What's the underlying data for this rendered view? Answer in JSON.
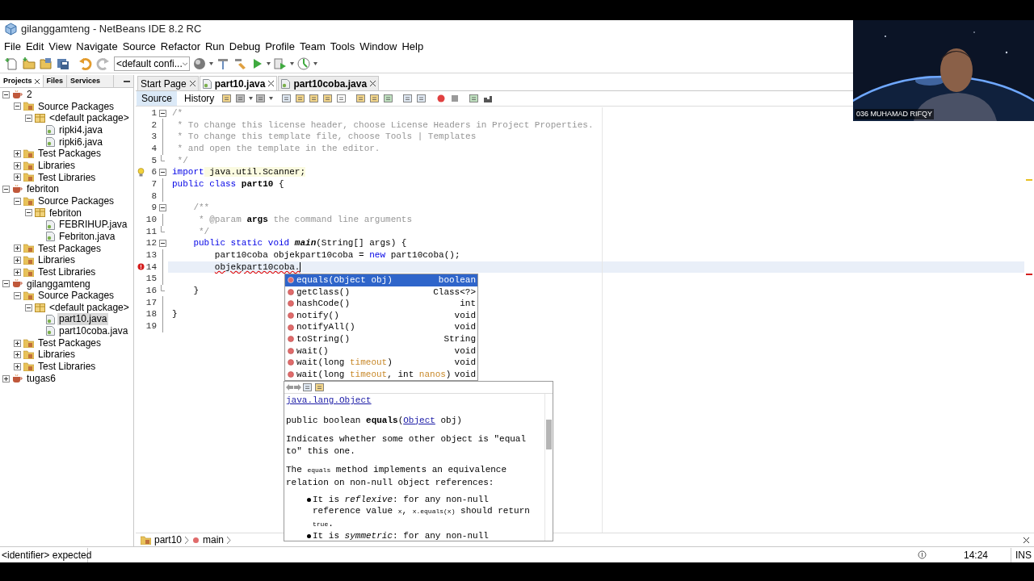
{
  "window": {
    "title": "gilanggamteng - NetBeans IDE 8.2 RC"
  },
  "menu": [
    "File",
    "Edit",
    "View",
    "Navigate",
    "Source",
    "Refactor",
    "Run",
    "Debug",
    "Profile",
    "Team",
    "Tools",
    "Window",
    "Help"
  ],
  "toolbar": {
    "config": "<default confi..."
  },
  "panel_tabs": [
    {
      "label": "Projects",
      "selected": true,
      "closable": true
    },
    {
      "label": "Files",
      "selected": false,
      "closable": false
    },
    {
      "label": "Services",
      "selected": false,
      "closable": false
    }
  ],
  "tree": [
    {
      "label": "2",
      "kind": "project",
      "expanded": true,
      "selected": false,
      "children": [
        {
          "label": "Source Packages",
          "kind": "folder",
          "expanded": true,
          "selected": false,
          "children": [
            {
              "label": "<default package>",
              "kind": "package",
              "expanded": true,
              "selected": false,
              "children": [
                {
                  "label": "ripki4.java",
                  "kind": "file",
                  "selected": false
                },
                {
                  "label": "ripki6.java",
                  "kind": "file",
                  "selected": false
                }
              ]
            }
          ]
        },
        {
          "label": "Test Packages",
          "kind": "folder",
          "expanded": false,
          "selected": false
        },
        {
          "label": "Libraries",
          "kind": "folder",
          "expanded": false,
          "selected": false
        },
        {
          "label": "Test Libraries",
          "kind": "folder",
          "expanded": false,
          "selected": false
        }
      ]
    },
    {
      "label": "febriton",
      "kind": "project",
      "expanded": true,
      "selected": false,
      "children": [
        {
          "label": "Source Packages",
          "kind": "folder",
          "expanded": true,
          "selected": false,
          "children": [
            {
              "label": "febriton",
              "kind": "package",
              "expanded": true,
              "selected": false,
              "children": [
                {
                  "label": "FEBRIHUP.java",
                  "kind": "file",
                  "selected": false
                },
                {
                  "label": "Febriton.java",
                  "kind": "file",
                  "selected": false
                }
              ]
            }
          ]
        },
        {
          "label": "Test Packages",
          "kind": "folder",
          "expanded": false,
          "selected": false
        },
        {
          "label": "Libraries",
          "kind": "folder",
          "expanded": false,
          "selected": false
        },
        {
          "label": "Test Libraries",
          "kind": "folder",
          "expanded": false,
          "selected": false
        }
      ]
    },
    {
      "label": "gilanggamteng",
      "kind": "project",
      "expanded": true,
      "selected": false,
      "children": [
        {
          "label": "Source Packages",
          "kind": "folder",
          "expanded": true,
          "selected": false,
          "children": [
            {
              "label": "<default package>",
              "kind": "package",
              "expanded": true,
              "selected": false,
              "children": [
                {
                  "label": "part10.java",
                  "kind": "file",
                  "selected": true
                },
                {
                  "label": "part10coba.java",
                  "kind": "file",
                  "selected": false
                }
              ]
            }
          ]
        },
        {
          "label": "Test Packages",
          "kind": "folder",
          "expanded": false,
          "selected": false
        },
        {
          "label": "Libraries",
          "kind": "folder",
          "expanded": false,
          "selected": false
        },
        {
          "label": "Test Libraries",
          "kind": "folder",
          "expanded": false,
          "selected": false
        }
      ]
    },
    {
      "label": "tugas6",
      "kind": "project",
      "expanded": false,
      "selected": false
    }
  ],
  "editor_tabs": [
    {
      "label": "Start Page",
      "selected": false,
      "modified": false
    },
    {
      "label": "part10.java",
      "selected": true,
      "modified": true
    },
    {
      "label": "part10coba.java",
      "selected": false,
      "modified": true
    }
  ],
  "view_toggle": [
    {
      "label": "Source",
      "selected": true
    },
    {
      "label": "History",
      "selected": false
    }
  ],
  "code_lines": [
    {
      "number": "1",
      "current": false,
      "expanded": true,
      "segments": [
        {
          "text": "/*",
          "kind": "comment"
        }
      ]
    },
    {
      "number": "2",
      "current": false,
      "segments": [
        {
          "text": " * To change this license header, choose License Headers in Project Properties.",
          "kind": "comment"
        }
      ]
    },
    {
      "number": "3",
      "current": false,
      "segments": [
        {
          "text": " * To change this template file, choose Tools | Templates",
          "kind": "comment"
        }
      ]
    },
    {
      "number": "4",
      "current": false,
      "segments": [
        {
          "text": " * and open the template in the editor.",
          "kind": "comment"
        }
      ]
    },
    {
      "number": "5",
      "current": false,
      "fold_end": true,
      "segments": [
        {
          "text": " */",
          "kind": "comment"
        }
      ]
    },
    {
      "number": "6",
      "current": false,
      "expanded": true,
      "hint": true,
      "segments": [
        {
          "text": "import",
          "kind": "keyword"
        },
        {
          "text": " java.util.Scanner;",
          "kind": "warning"
        }
      ]
    },
    {
      "number": "7",
      "current": false,
      "segments": [
        {
          "text": "public class ",
          "kind": "keyword"
        },
        {
          "text": "part10",
          "kind": "bold"
        },
        {
          "text": " {",
          "kind": "plain"
        }
      ]
    },
    {
      "number": "8",
      "current": false
    },
    {
      "number": "9",
      "current": false,
      "expanded": true,
      "segments": [
        {
          "text": "    /**",
          "kind": "comment"
        }
      ]
    },
    {
      "number": "10",
      "current": false,
      "segments": [
        {
          "text": "     * @param ",
          "kind": "comment"
        },
        {
          "text": "args",
          "kind": "bold"
        },
        {
          "text": " the command line arguments",
          "kind": "comment"
        }
      ]
    },
    {
      "number": "11",
      "current": false,
      "fold_end": true,
      "segments": [
        {
          "text": "     */",
          "kind": "comment"
        }
      ]
    },
    {
      "number": "12",
      "current": false,
      "expanded": true,
      "segments": [
        {
          "text": "    public static void ",
          "kind": "keyword"
        },
        {
          "text": "main",
          "kind": "method"
        },
        {
          "text": "(String[] args) {",
          "kind": "plain"
        }
      ]
    },
    {
      "number": "13",
      "current": false,
      "segments": [
        {
          "text": "        part10coba objekpart10coba = ",
          "kind": "plain"
        },
        {
          "text": "new",
          "kind": "keyword"
        },
        {
          "text": " part10coba();",
          "kind": "plain"
        }
      ]
    },
    {
      "number": "14",
      "current": true,
      "error": true,
      "segments": [
        {
          "text": "        objekpart10coba.",
          "kind": "error"
        }
      ]
    },
    {
      "number": "15",
      "current": false
    },
    {
      "number": "16",
      "current": false,
      "fold_end": true,
      "segments": [
        {
          "text": "    }",
          "kind": "plain"
        }
      ]
    },
    {
      "number": "17",
      "current": false
    },
    {
      "number": "18",
      "current": false,
      "segments": [
        {
          "text": "}",
          "kind": "plain"
        }
      ]
    },
    {
      "number": "19",
      "current": false
    }
  ],
  "completion": [
    {
      "selected": true,
      "segments": [
        {
          "text": "equals(Object obj)",
          "kind": "plain"
        }
      ],
      "type": "boolean"
    },
    {
      "selected": false,
      "segments": [
        {
          "text": "getClass()",
          "kind": "plain"
        }
      ],
      "type": "Class<?>"
    },
    {
      "selected": false,
      "segments": [
        {
          "text": "hashCode()",
          "kind": "plain"
        }
      ],
      "type": "int"
    },
    {
      "selected": false,
      "segments": [
        {
          "text": "notify()",
          "kind": "plain"
        }
      ],
      "type": "void"
    },
    {
      "selected": false,
      "segments": [
        {
          "text": "notifyAll()",
          "kind": "plain"
        }
      ],
      "type": "void"
    },
    {
      "selected": false,
      "segments": [
        {
          "text": "toString()",
          "kind": "plain"
        }
      ],
      "type": "String"
    },
    {
      "selected": false,
      "segments": [
        {
          "text": "wait()",
          "kind": "plain"
        }
      ],
      "type": "void"
    },
    {
      "selected": false,
      "segments": [
        {
          "text": "wait(long ",
          "kind": "plain"
        },
        {
          "text": "timeout",
          "kind": "param"
        },
        {
          "text": ")",
          "kind": "plain"
        }
      ],
      "type": "void"
    },
    {
      "selected": false,
      "segments": [
        {
          "text": "wait(long ",
          "kind": "plain"
        },
        {
          "text": "timeout",
          "kind": "param"
        },
        {
          "text": ", int ",
          "kind": "plain"
        },
        {
          "text": "nanos",
          "kind": "param"
        },
        {
          "text": ")",
          "kind": "plain"
        }
      ],
      "type": "void"
    }
  ],
  "javadoc": {
    "class_link": "java.lang.Object",
    "signature": [
      {
        "text": "public boolean ",
        "kind": "plain"
      },
      {
        "text": "equals",
        "kind": "bold"
      },
      {
        "text": "(",
        "kind": "plain"
      },
      {
        "text": "Object",
        "kind": "link"
      },
      {
        "text": " obj)",
        "kind": "plain"
      }
    ],
    "paragraphs": [
      [
        {
          "text": "Indicates whether some other object is \"equal to\" this one.",
          "kind": "plain"
        }
      ],
      [
        {
          "text": "The ",
          "kind": "plain"
        },
        {
          "text": "equals",
          "kind": "code"
        },
        {
          "text": " method implements an equivalence relation on non-null object references:",
          "kind": "plain"
        }
      ]
    ],
    "bullets": [
      [
        {
          "text": "It is ",
          "kind": "plain"
        },
        {
          "text": "reflexive",
          "kind": "italic"
        },
        {
          "text": ": for any non-null reference value ",
          "kind": "plain"
        },
        {
          "text": "x",
          "kind": "code"
        },
        {
          "text": ", ",
          "kind": "plain"
        },
        {
          "text": "x.equals(x)",
          "kind": "code"
        },
        {
          "text": " should return ",
          "kind": "plain"
        },
        {
          "text": "true",
          "kind": "code"
        },
        {
          "text": ".",
          "kind": "plain"
        }
      ],
      [
        {
          "text": "It is ",
          "kind": "plain"
        },
        {
          "text": "symmetric",
          "kind": "italic"
        },
        {
          "text": ": for any non-null",
          "kind": "plain"
        }
      ]
    ]
  },
  "breadcrumbs": [
    "part10",
    "main"
  ],
  "status": {
    "message": "<identifier> expected",
    "position": "14:24",
    "mode": "INS"
  },
  "webcam": {
    "name": "036 MUHAMAD RIFQY"
  }
}
